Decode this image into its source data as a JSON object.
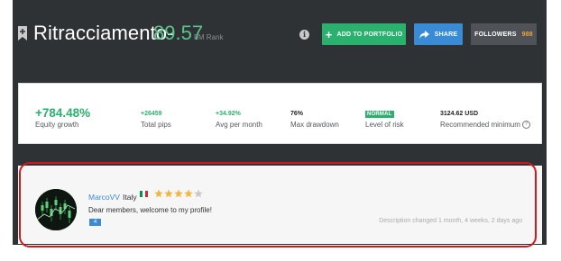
{
  "header": {
    "title": "Ritracciamento-",
    "score": "89.57",
    "rank_label": "FM Rank",
    "info_icon": "info-icon",
    "add_portfolio_label": "ADD TO PORTFOLIO",
    "share_label": "SHARE",
    "followers_label": "FOLLOWERS",
    "followers_count": "988"
  },
  "stats": [
    {
      "value": "+784.48%",
      "label": "Equity growth"
    },
    {
      "value": "+26459",
      "label": "Total pips"
    },
    {
      "value": "+34.92%",
      "label": "Avg per month"
    },
    {
      "value": "76%",
      "label": "Max drawdown"
    },
    {
      "value": "NORMAL",
      "label": "Level of risk"
    },
    {
      "value": "3124.62 USD",
      "label": "Recommended minimum"
    }
  ],
  "profile": {
    "username": "MarcoVV",
    "country": "Italy",
    "rating_stars": 4,
    "rating_max": 5,
    "welcome_text": "Dear members, welcome to my profile!",
    "comment_count": "4",
    "description_changed": "Description changed 1 month, 4 weeks, 2 days ago"
  },
  "colors": {
    "header_bg": "#2f3235",
    "accent_green": "#2bb16e",
    "share_blue": "#3a8bd6",
    "followers_orange": "#f0a13a",
    "star_gold": "#f3b63c",
    "highlight_red": "#d0191d"
  }
}
